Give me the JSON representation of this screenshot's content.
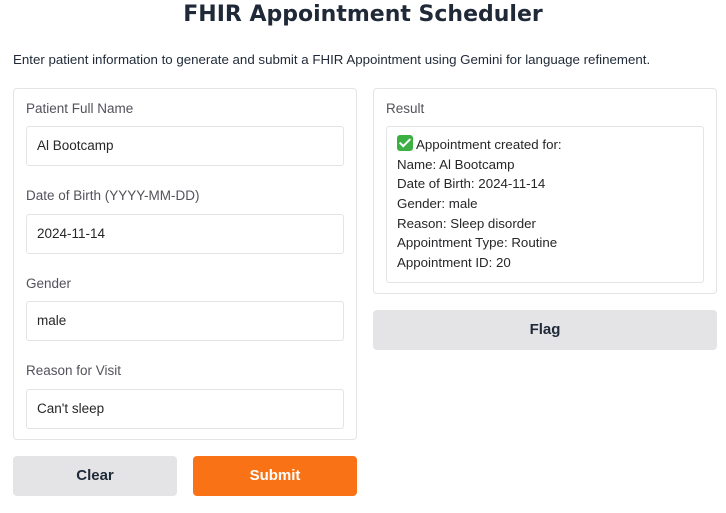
{
  "header": {
    "title": "FHIR Appointment Scheduler",
    "description": "Enter patient information to generate and submit a FHIR Appointment using Gemini for language refinement."
  },
  "form": {
    "name_label": "Patient Full Name",
    "name_value": "Al Bootcamp",
    "dob_label": "Date of Birth (YYYY-MM-DD)",
    "dob_value": "2024-11-14",
    "gender_label": "Gender",
    "gender_value": "male",
    "reason_label": "Reason for Visit",
    "reason_value": "Can't sleep"
  },
  "result": {
    "label": "Result",
    "status_icon": "check-mark-icon",
    "lines": [
      "Appointment created for:",
      "Name: Al Bootcamp",
      "Date of Birth: 2024-11-14",
      "Gender: male",
      "Reason: Sleep disorder",
      "Appointment Type: Routine",
      "Appointment ID: 20"
    ]
  },
  "buttons": {
    "clear_label": "Clear",
    "submit_label": "Submit",
    "flag_label": "Flag"
  },
  "colors": {
    "submit_accent": "#f97316",
    "secondary_button": "#e4e4e7",
    "check_green": "#3cb043"
  }
}
